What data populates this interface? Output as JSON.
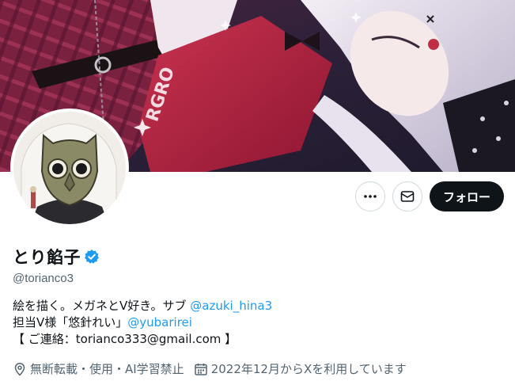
{
  "profile": {
    "display_name": "とり餡子",
    "verified_icon": "verified-badge-icon",
    "handle": "@torianco3",
    "bio": {
      "line1_text": "絵を描く。メガネとV好き。サブ ",
      "line1_link": "@azuki_hina3",
      "line2_text": "担当V様「悠針れい」",
      "line2_link": "@yubarirei",
      "line3_text": "【 ご連絡：torianco333@gmail.com 】"
    },
    "location": "無断転載・使用・AI学習禁止",
    "joined": "2022年12月からXを利用しています"
  },
  "actions": {
    "more_icon": "more-dots-icon",
    "message_icon": "envelope-icon",
    "follow_label": "フォロー"
  },
  "colors": {
    "accent": "#1d9bf0",
    "follow_bg": "#0f1419",
    "muted_text": "#536471",
    "border": "#cfd9de"
  }
}
